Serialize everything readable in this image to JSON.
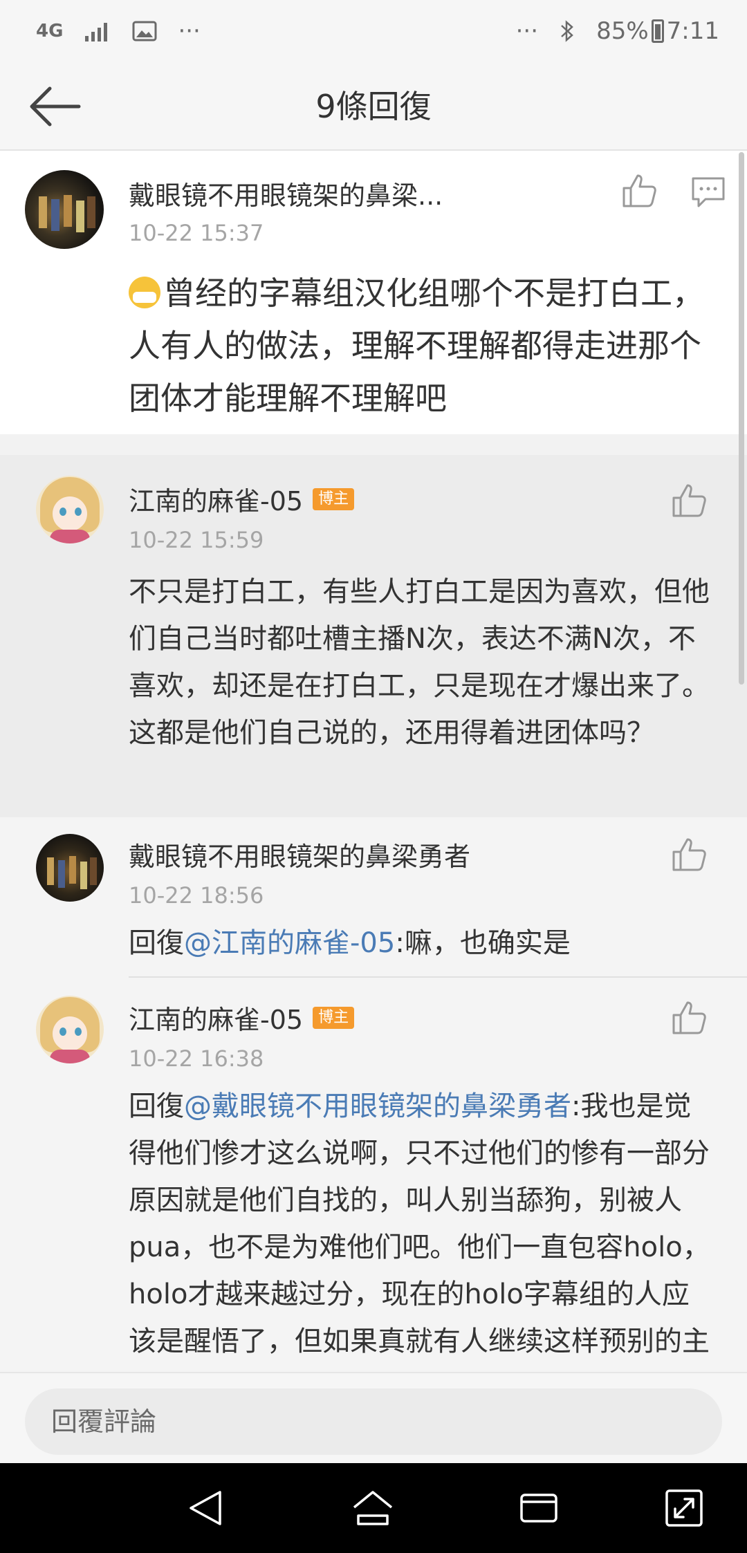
{
  "status_bar": {
    "network": "4G",
    "battery": "85%",
    "time": "7:11",
    "more_dots_left": "···",
    "more_dots_right": "···"
  },
  "header": {
    "title": "9條回復"
  },
  "main_comment": {
    "author": "戴眼镜不用眼镜架的鼻梁...",
    "time": "10-22 15:37",
    "text": "曾经的字幕组汉化组哪个不是打白工，人有人的做法，理解不理解都得走进那个团体才能理解不理解吧"
  },
  "replies": [
    {
      "author": "江南的麻雀-05",
      "badge": "博主",
      "time": "10-22 15:59",
      "text": "不只是打白工，有些人打白工是因为喜欢，但他们自己当时都吐槽主播N次，表达不满N次，不喜欢，却还是在打白工，只是现在才爆出来了。这都是他们自己说的，还用得着进团体吗？"
    },
    {
      "author": "戴眼镜不用眼镜架的鼻梁勇者",
      "time": "10-22 18:56",
      "reply_prefix": "回復",
      "mention": "@江南的麻雀-05",
      "text": ":嘛，也确实是"
    },
    {
      "author": "江南的麻雀-05",
      "badge": "博主",
      "time": "10-22 16:38",
      "reply_prefix": "回復",
      "mention": "@戴眼镜不用眼镜架的鼻梁勇者",
      "text": ":我也是觉得他们惨才这么说啊，只不过他们的惨有一部分原因就是他们自找的，叫人别当舔狗，别被人pua，也不是为难他们吧。他们一直包容holo，holo才越来越过分，现在的holo字幕组的人应该是醒悟了，但如果真就有人继续这样预别的主播，或者holo之外的字幕组也这么"
    }
  ],
  "reply_input": {
    "placeholder": "回覆評論"
  },
  "icons": [
    "back-arrow-icon",
    "like-icon",
    "comment-icon",
    "back-nav-icon",
    "home-nav-icon",
    "recents-nav-icon",
    "expand-nav-icon"
  ]
}
